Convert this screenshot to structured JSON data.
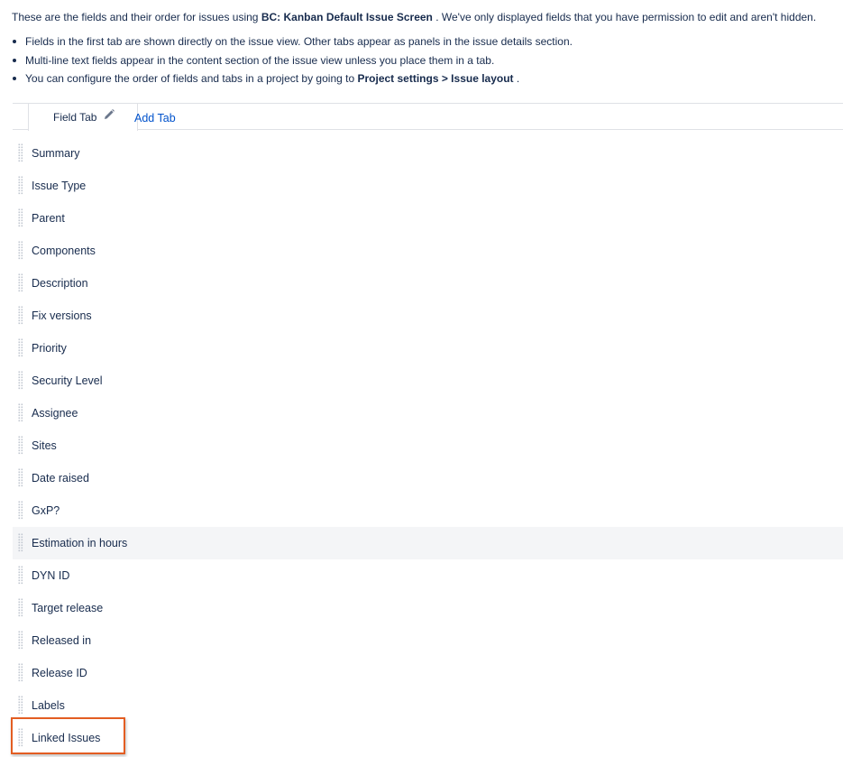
{
  "intro": {
    "prefix": "These are the fields and their order for issues using",
    "screen_name": "BC: Kanban Default Issue Screen",
    "suffix": ". We've only displayed fields that you have permission to edit and aren't hidden."
  },
  "notes": [
    {
      "text": "Fields in the first tab are shown directly on the issue view. Other tabs appear as panels in the issue details section."
    },
    {
      "text": "Multi-line text fields appear in the content section of the issue view unless you place them in a tab."
    },
    {
      "prefix": "You can configure the order of fields and tabs in a project by going to",
      "bold": "Project settings > Issue layout",
      "suffix": "."
    }
  ],
  "tabs": {
    "active_label": "Field Tab",
    "add_label": "Add Tab",
    "edit_icon": "pencil-icon"
  },
  "fields": [
    "Summary",
    "Issue Type",
    "Parent",
    "Components",
    "Description",
    "Fix versions",
    "Priority",
    "Security Level",
    "Assignee",
    "Sites",
    "Date raised",
    "GxP?",
    "Estimation in hours",
    "DYN ID",
    "Target release",
    "Released in",
    "Release ID",
    "Labels",
    "Linked Issues"
  ],
  "hovered_field": "Estimation in hours",
  "highlighted_field": "Linked Issues",
  "colors": {
    "text": "#172b4d",
    "link": "#0052cc",
    "border": "#dfe1e6",
    "hover_row": "#f4f5f7",
    "highlight": "#e35d22"
  }
}
